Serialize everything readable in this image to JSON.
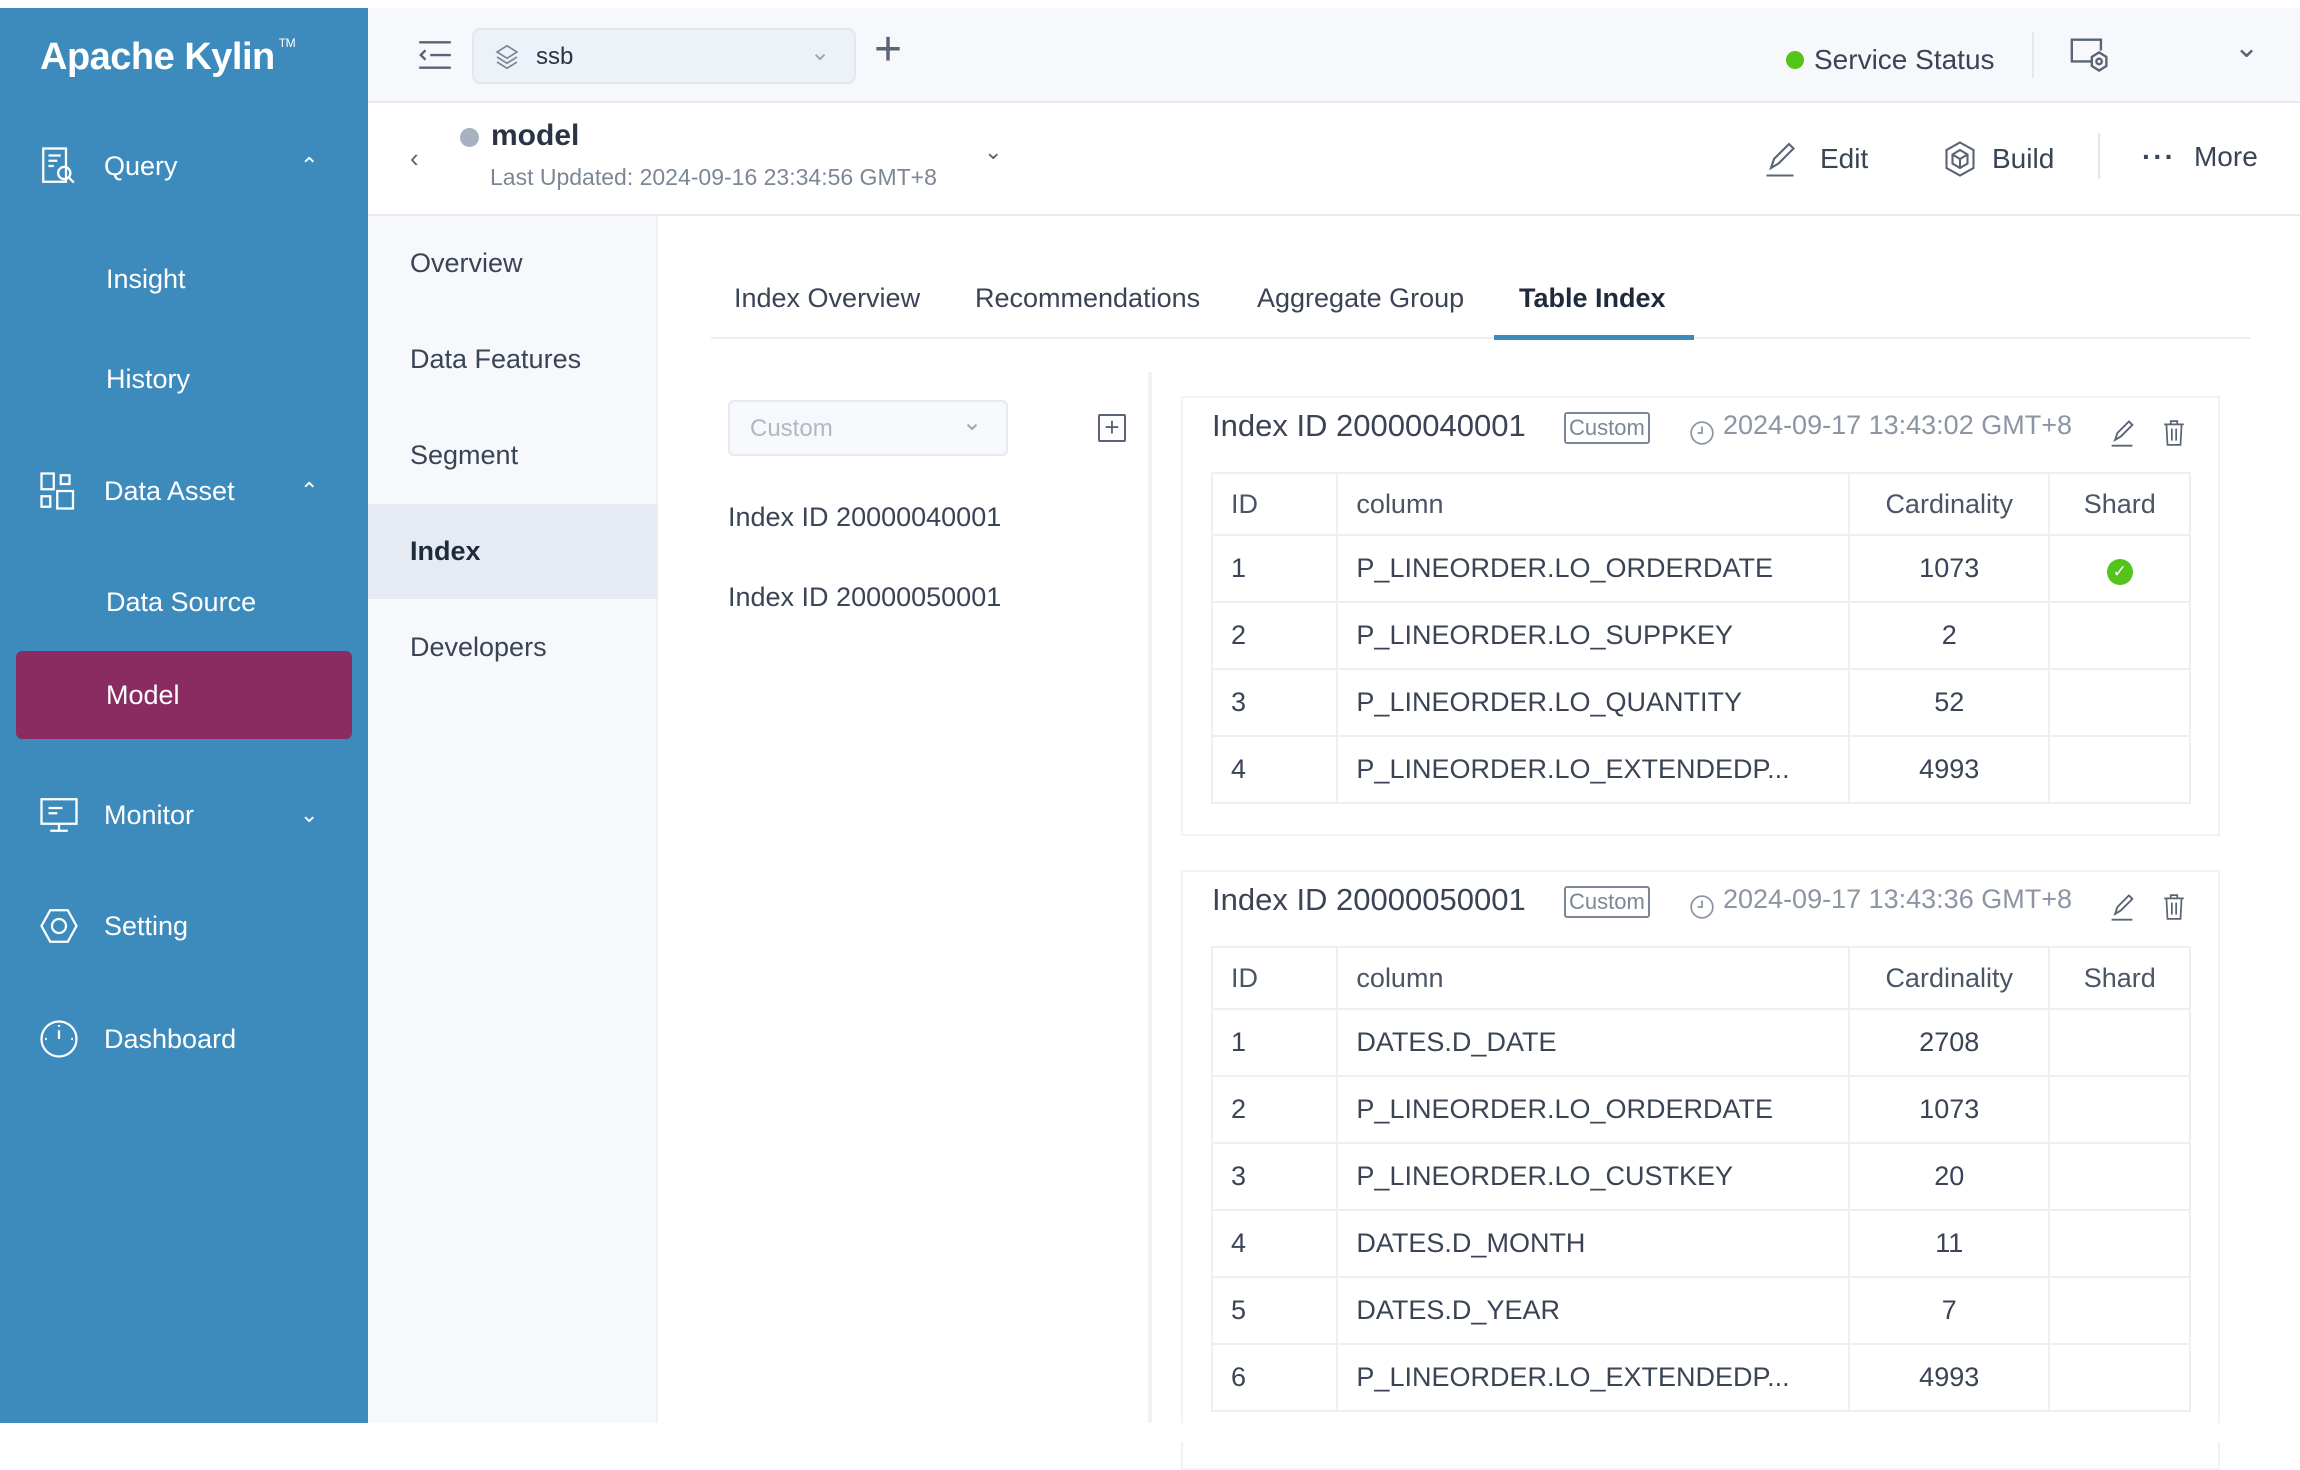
{
  "app": {
    "title": "Apache Kylin",
    "tm": "TM"
  },
  "sidebar": {
    "items": [
      {
        "label": "Query",
        "icon": "query-icon",
        "expanded": true
      },
      {
        "label": "Insight"
      },
      {
        "label": "History"
      },
      {
        "label": "Data Asset",
        "icon": "data-asset-icon",
        "expanded": true
      },
      {
        "label": "Data Source"
      },
      {
        "label": "Model",
        "active": true
      },
      {
        "label": "Monitor",
        "icon": "monitor-icon",
        "expanded": false
      },
      {
        "label": "Setting",
        "icon": "setting-icon"
      },
      {
        "label": "Dashboard",
        "icon": "dashboard-icon"
      }
    ],
    "colors": {
      "bg": "#3d8bbd",
      "active": "#8a2c61"
    }
  },
  "topbar": {
    "project": "ssb",
    "service_status": "Service Status",
    "status_color": "#52c41a"
  },
  "model": {
    "name": "model",
    "last_updated": "Last Updated: 2024-09-16 23:34:56 GMT+8",
    "actions": {
      "edit": "Edit",
      "build": "Build",
      "more": "More"
    }
  },
  "subnav": {
    "items": [
      "Overview",
      "Data Features",
      "Segment",
      "Index",
      "Developers"
    ],
    "active": "Index"
  },
  "tabs": {
    "items": [
      "Index Overview",
      "Recommendations",
      "Aggregate Group",
      "Table Index"
    ],
    "active": "Table Index"
  },
  "index_list": {
    "filter": "Custom",
    "items": [
      "Index ID 20000040001",
      "Index ID 20000050001"
    ]
  },
  "cards": [
    {
      "title": "Index ID 20000040001",
      "badge": "Custom",
      "time": "2024-09-17 13:43:02 GMT+8",
      "headers": [
        "ID",
        "column",
        "Cardinality",
        "Shard"
      ],
      "rows": [
        [
          "1",
          "P_LINEORDER.LO_ORDERDATE",
          "1073",
          true
        ],
        [
          "2",
          "P_LINEORDER.LO_SUPPKEY",
          "2",
          false
        ],
        [
          "3",
          "P_LINEORDER.LO_QUANTITY",
          "52",
          false
        ],
        [
          "4",
          "P_LINEORDER.LO_EXTENDEDP...",
          "4993",
          false
        ]
      ]
    },
    {
      "title": "Index ID 20000050001",
      "badge": "Custom",
      "time": "2024-09-17 13:43:36 GMT+8",
      "headers": [
        "ID",
        "column",
        "Cardinality",
        "Shard"
      ],
      "rows": [
        [
          "1",
          "DATES.D_DATE",
          "2708",
          false
        ],
        [
          "2",
          "P_LINEORDER.LO_ORDERDATE",
          "1073",
          false
        ],
        [
          "3",
          "P_LINEORDER.LO_CUSTKEY",
          "20",
          false
        ],
        [
          "4",
          "DATES.D_MONTH",
          "11",
          false
        ],
        [
          "5",
          "DATES.D_YEAR",
          "7",
          false
        ],
        [
          "6",
          "P_LINEORDER.LO_EXTENDEDP...",
          "4993",
          false
        ]
      ]
    }
  ]
}
